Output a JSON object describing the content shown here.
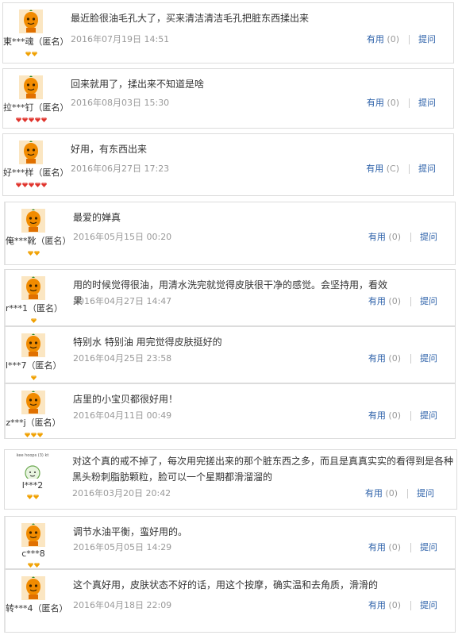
{
  "colors": {
    "link": "#2a5fa8",
    "date": "#999999",
    "border": "#dcdcdc",
    "gem_yellow": "#f0a000",
    "gem_red": "#e0322b"
  },
  "action_labels": {
    "useful": "有用",
    "ask": "提问"
  },
  "reviews": [
    {
      "user": "東***魂（匿名）",
      "badge": "yellow",
      "badge_count": 2,
      "text": "最近脸很油毛孔大了，买来清洁清洁毛孔把脏东西揉出来",
      "date": "2016年07月19日 14:51",
      "useful_count": "(0)",
      "avatar": "orange"
    },
    {
      "user": "拉***钉（匿名）",
      "badge": "red",
      "badge_count": 5,
      "text": "回来就用了，揉出来不知道是啥",
      "date": "2016年08月03日 15:30",
      "useful_count": "(0)",
      "avatar": "orange"
    },
    {
      "user": "好***样（匿名）",
      "badge": "red",
      "badge_count": 5,
      "text": "好用，有东西出来",
      "date": "2016年06月27日 17:23",
      "useful_count": "(C)",
      "avatar": "orange"
    },
    {
      "user": "俺***靴（匿名）",
      "badge": "yellow",
      "badge_count": 2,
      "text": "最爱的婵真",
      "date": "2016年05月15日 00:20",
      "useful_count": "(0)",
      "avatar": "orange"
    },
    {
      "user": "r***1（匿名）",
      "badge": "yellow",
      "badge_count": 1,
      "text": "用的时候觉得很油，用清水洗完就觉得皮肤很干净的感觉。会坚持用，看效果",
      "date": "2016年04月27日 14:47",
      "useful_count": "(0)",
      "avatar": "orange"
    },
    {
      "user": "l***7（匿名）",
      "badge": "yellow",
      "badge_count": 1,
      "text": "特别水 特别油 用完觉得皮肤挺好的",
      "date": "2016年04月25日 23:58",
      "useful_count": "(0)",
      "avatar": "orange"
    },
    {
      "user": "z***j（匿名）",
      "badge": "yellow",
      "badge_count": 3,
      "text": "店里的小宝贝都很好用！",
      "date": "2016年04月11日 00:49",
      "useful_count": "(0)",
      "avatar": "orange"
    },
    {
      "user": "l***2",
      "badge": "yellow",
      "badge_count": 2,
      "text": "对这个真的戒不掉了，每次用完搓出来的那个脏东西之多，而且是真真实实的看得到是各种黑头粉刺脂肪颗粒，脸可以一个星期都滑溜溜的",
      "date": "2016年03月20日 20:42",
      "useful_count": "(0)",
      "avatar": "custom",
      "avatar_caption": "kee hoops (3) kt"
    },
    {
      "user": "c***8",
      "badge": "yellow",
      "badge_count": 2,
      "text": "调节水油平衡，蛮好用的。",
      "date": "2016年05月05日 14:29",
      "useful_count": "(0)",
      "avatar": "orange"
    },
    {
      "user": "转***4（匿名）",
      "badge": "yellow",
      "badge_count": 0,
      "text": "这个真好用，皮肤状态不好的话，用这个按摩，确实温和去角质，滑滑的",
      "date": "2016年04月18日 22:09",
      "useful_count": "(0)",
      "avatar": "orange"
    }
  ]
}
